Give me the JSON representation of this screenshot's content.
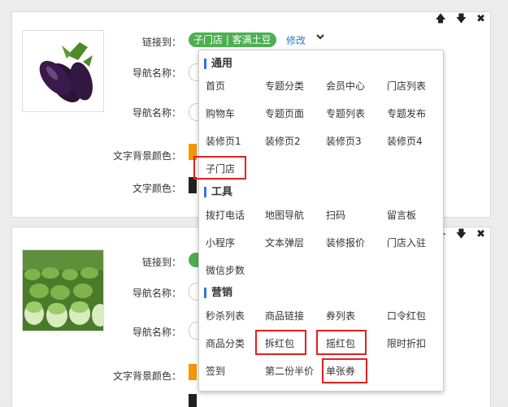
{
  "controls": {
    "up": "🡅",
    "down": "🡇",
    "close": "✖"
  },
  "card1": {
    "link_label": "链接到：",
    "link_value": "子门店 | 客满土豆",
    "edit_label": "修改",
    "nav_name_label": "导航名称：",
    "nav_name_label2": "导航名称：",
    "bg_color_label": "文字背景颜色：",
    "text_color_label": "文字颜色："
  },
  "card2": {
    "link_label": "链接到：",
    "nav_name_label": "导航名称：",
    "nav_name_label2": "导航名称：",
    "bg_color_label": "文字背景颜色："
  },
  "menu": {
    "sections": [
      {
        "title": "通用",
        "items": [
          "首页",
          "专题分类",
          "会员中心",
          "门店列表",
          "购物车",
          "专题页面",
          "专题列表",
          "专题发布",
          "装修页1",
          "装修页2",
          "装修页3",
          "装修页4",
          "子门店"
        ]
      },
      {
        "title": "工具",
        "items": [
          "拨打电话",
          "地图导航",
          "扫码",
          "留言板",
          "小程序",
          "文本弹层",
          "装修报价",
          "门店入驻",
          "微信步数"
        ]
      },
      {
        "title": "营销",
        "items": [
          "秒杀列表",
          "商品链接",
          "券列表",
          "口令红包",
          "商品分类",
          "拆红包",
          "摇红包",
          "限时折扣",
          "签到",
          "第二份半价",
          "单张券"
        ]
      }
    ]
  },
  "colors": {
    "accent": "#4caf50",
    "link": "#2a7ad1",
    "highlight": "#e02020",
    "swatch": "#f39800"
  }
}
